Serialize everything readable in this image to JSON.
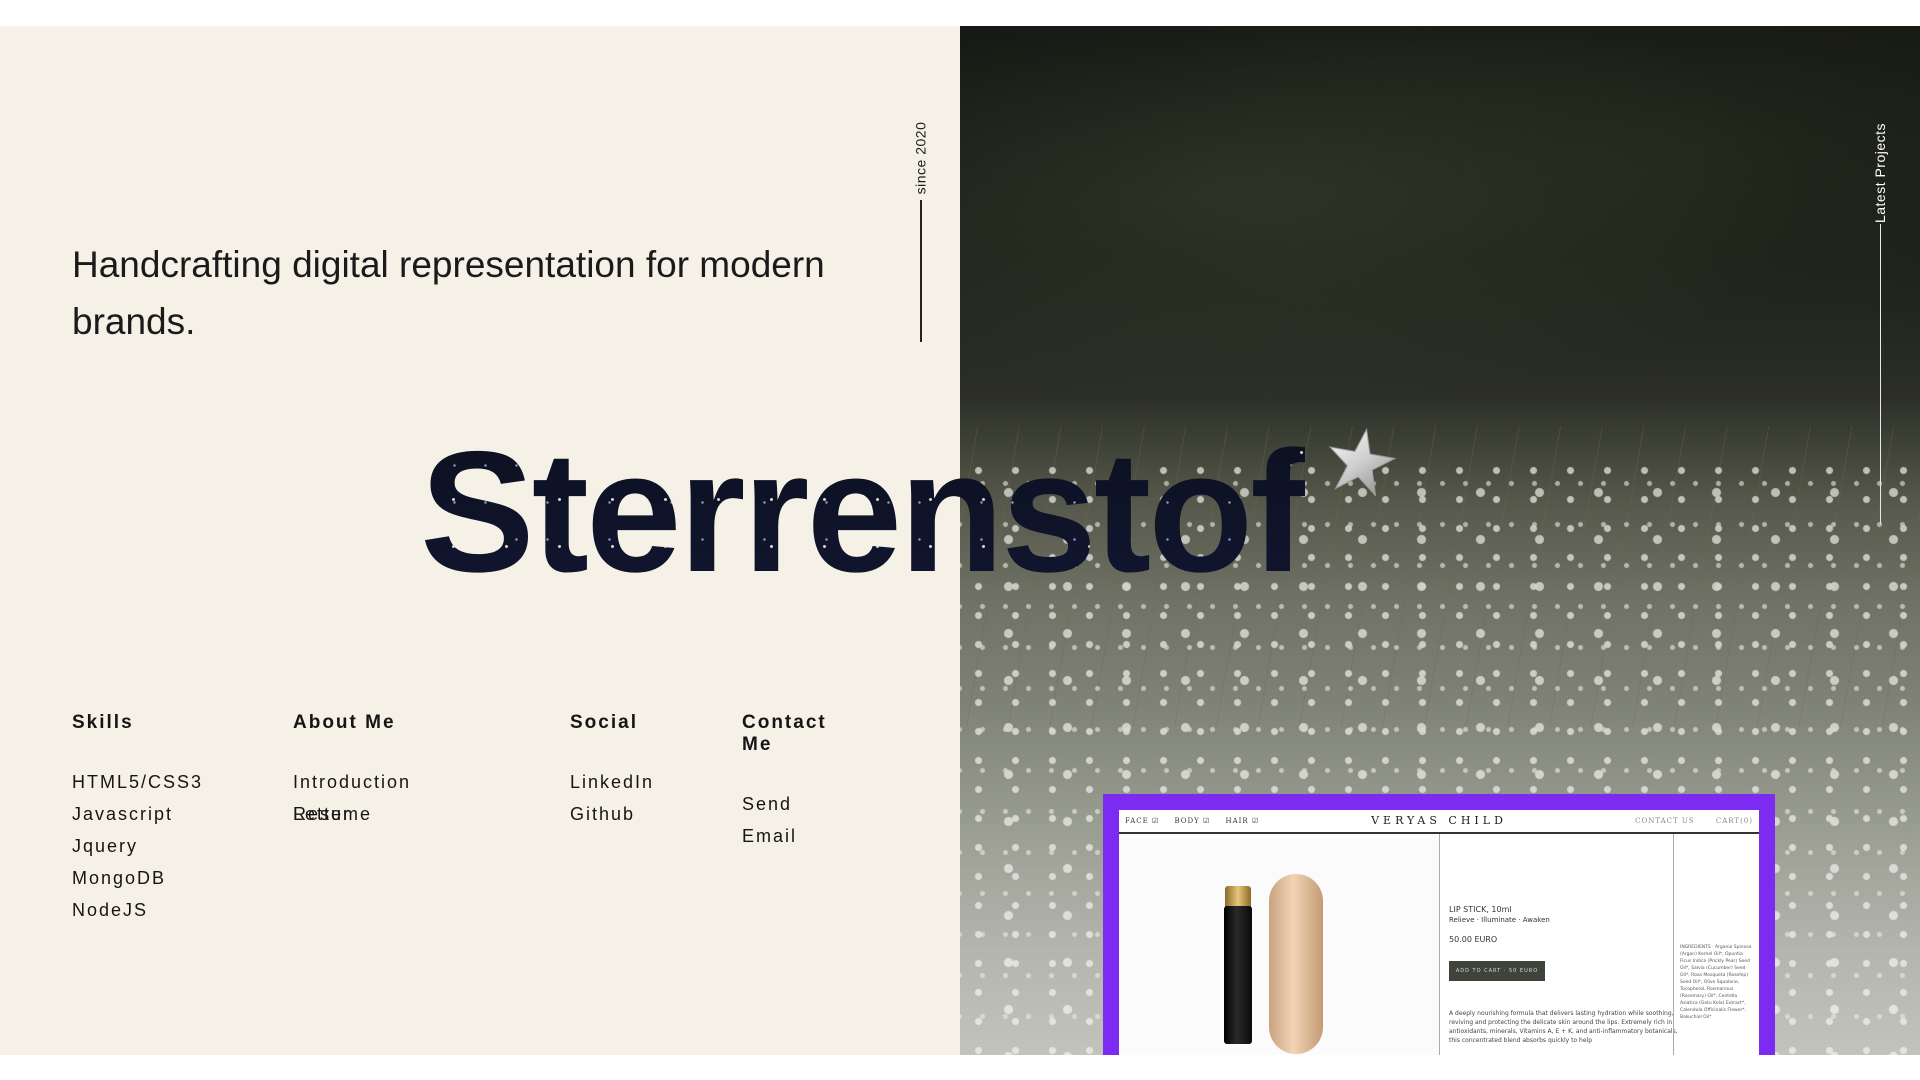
{
  "hero": {
    "since": "since 2020",
    "tagline": "Handcrafting digital representation for modern brands.",
    "brand": "Sterrenstof",
    "brand_icon": "star-icon"
  },
  "side_label": "Latest Projects",
  "columns": {
    "skills": {
      "heading": "Skills",
      "items": [
        "HTML5/CSS3",
        "Javascript",
        "Jquery",
        "MongoDB",
        "NodeJS"
      ]
    },
    "about": {
      "heading": "About Me",
      "items": [
        "Introduction Letter",
        "Resume"
      ]
    },
    "social": {
      "heading": "Social",
      "items": [
        "LinkedIn",
        "Github"
      ]
    },
    "contact": {
      "heading": "Contact Me",
      "items": [
        "Send Email"
      ]
    }
  },
  "project": {
    "border_color": "#7b2cf0",
    "nav": {
      "cats": [
        "FACE ☑",
        "BODY ☑",
        "HAIR ☑"
      ],
      "logo": "VERYAS CHILD",
      "right": [
        "CONTACT US",
        "CART(0)"
      ]
    },
    "product": {
      "title": "LIP STICK,   10ml",
      "subtitle": "Relieve · Illuminate · Awaken",
      "price": "50.00 EURO",
      "buy": "ADD TO CART · 50 EURO",
      "description": "A deeply nourishing formula that delivers lasting hydration while soothing, reviving and protecting the delicate skin around the lips. Extremely rich in antioxidants, minerals, Vitamins A, E + K, and anti-inflammatory botanicals, this concentrated blend absorbs quickly to help",
      "ingredients": "INGREDIENTS · Argania Spinosa (Argan) Kernel Oil*, Opuntia Ficus Indica (Prickly Pear) Seed Oil*, Salvia (Cucumber) Seed Oil*, Rosa Mosqueta (Rosehip) Seed Oil*, Olive Squalane, Tocopherol, Rosmarinus (Rosemary) Oil*, Centella Asiatica (Gotu Kola) Extract*, Calendula Officinalis Flower*, Bakuchiol Oil*"
    }
  },
  "colors": {
    "left_bg": "#f5f1e6",
    "text": "#151515",
    "accent": "#7b2cf0"
  }
}
